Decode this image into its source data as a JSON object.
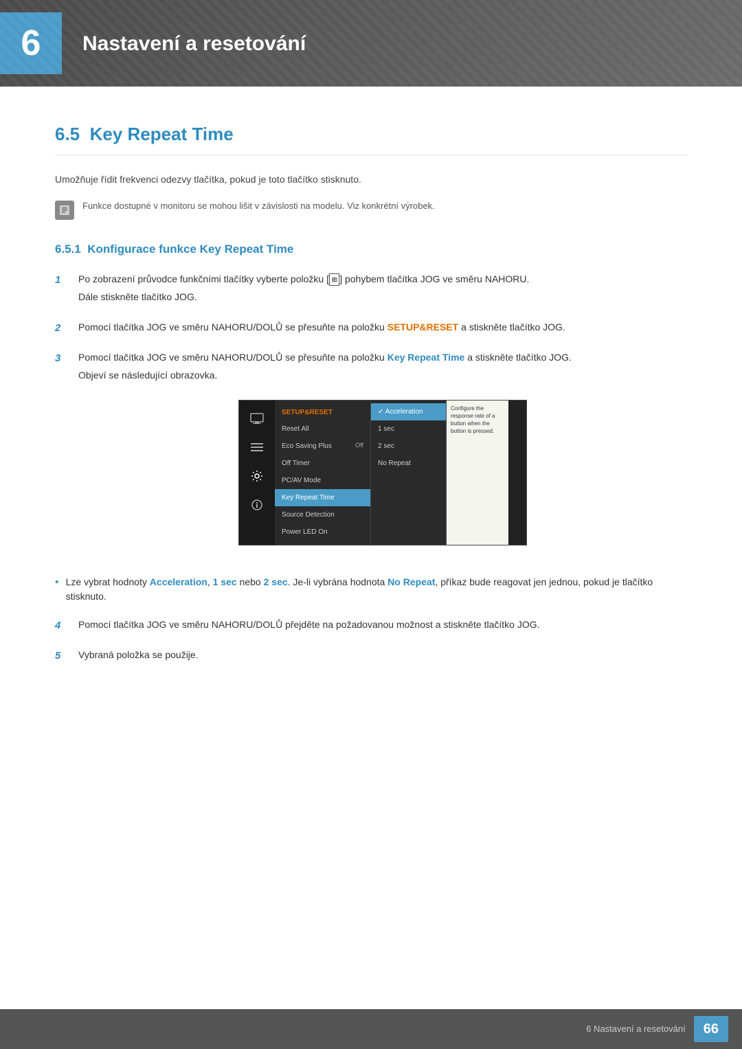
{
  "chapter": {
    "number": "6",
    "title": "Nastavení a resetování",
    "accent_color": "#4a9cc7"
  },
  "section": {
    "number": "6.5",
    "title": "Key Repeat Time",
    "intro": "Umožňuje řídit frekvenci odezvy tlačítka, pokud je toto tlačítko stisknuto.",
    "note": "Funkce dostupné v monitoru se mohou lišit v závislosti na modelu. Viz konkrétní výrobek."
  },
  "subsection": {
    "number": "6.5.1",
    "title": "Konfigurace funkce Key Repeat Time"
  },
  "steps": [
    {
      "number": "1",
      "text": "Po zobrazení průvodce funkčními tlačítky vyberte položku [",
      "text2": "] pohybem tlačítka JOG ve směru NAHORU.",
      "sub": "Dále stiskněte tlačítko JOG."
    },
    {
      "number": "2",
      "text": "Pomocí tlačítka JOG ve směru NAHORU/DOLŮ se přesuňte na položku ",
      "highlight": "SETUP&RESET",
      "text2": " a stiskněte tlačítko JOG."
    },
    {
      "number": "3",
      "text": "Pomocí tlačítka JOG ve směru NAHORU/DOLŮ se přesuňte na položku ",
      "highlight": "Key Repeat Time",
      "text2": " a stiskněte tlačítko JOG.",
      "sub": "Objeví se následující obrazovka."
    },
    {
      "number": "4",
      "text": "Pomocí tlačítka JOG ve směru NAHORU/DOLŮ přejděte na požadovanou možnost a stiskněte tlačítko JOG."
    },
    {
      "number": "5",
      "text": "Vybraná položka se použije."
    }
  ],
  "screenshot": {
    "menu_header": "SETUP&RESET",
    "menu_items": [
      {
        "label": "Reset All",
        "value": ""
      },
      {
        "label": "Eco Saving Plus",
        "value": "Off"
      },
      {
        "label": "Off Timer",
        "value": ""
      },
      {
        "label": "PC/AV Mode",
        "value": ""
      },
      {
        "label": "Key Repeat Time",
        "value": "",
        "active": true
      },
      {
        "label": "Source Detection",
        "value": ""
      },
      {
        "label": "Power LED On",
        "value": ""
      }
    ],
    "submenu_items": [
      {
        "label": "Acceleration",
        "active": true,
        "checkmark": true
      },
      {
        "label": "1 sec"
      },
      {
        "label": "2 sec"
      },
      {
        "label": "No Repeat"
      }
    ],
    "tooltip": "Configure the response rate of a button when the button is pressed."
  },
  "bullet": {
    "text": "Lze vybrat hodnoty ",
    "highlight1": "Acceleration",
    "sep1": ", ",
    "highlight2": "1 sec",
    "sep2": " nebo ",
    "highlight3": "2 sec",
    "text2": ". Je-li vybrána hodnota ",
    "highlight4": "No Repeat",
    "text3": ", příkaz bude reagovat jen jednou, pokud je tlačítko stisknuto."
  },
  "footer": {
    "text": "6 Nastavení a resetování",
    "page": "66"
  }
}
